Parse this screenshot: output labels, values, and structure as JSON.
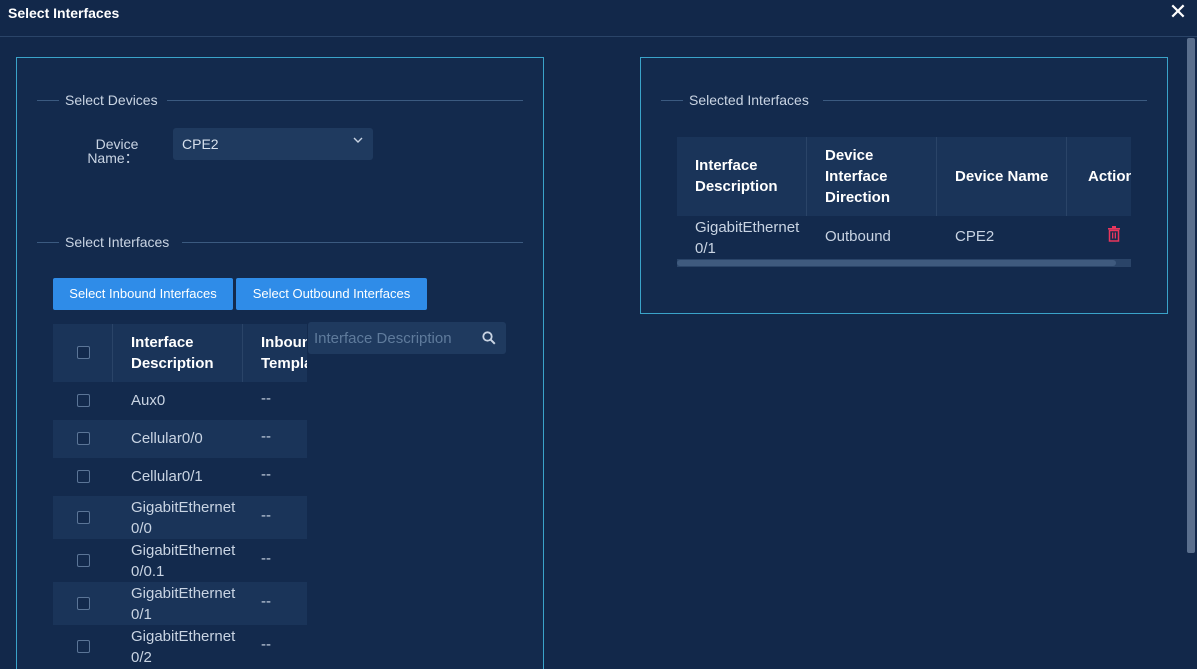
{
  "dialog": {
    "title": "Select Interfaces",
    "close_icon": "close-icon"
  },
  "left_panel": {
    "devices_section": "Select Devices",
    "device_name_label_1": "Device",
    "device_name_label_2": "Name：",
    "device_name_value": "CPE2",
    "interfaces_section": "Select Interfaces",
    "btn_inbound": "Select Inbound Interfaces",
    "btn_outbound": "Select Outbound Interfaces",
    "search_placeholder": "Interface Description",
    "table": {
      "col_desc_1": "Interface",
      "col_desc_2": "Description",
      "col_tmpl_1": "Inbound",
      "col_tmpl_2": "Template",
      "rows": [
        {
          "desc1": "Aux0",
          "desc2": "",
          "tmpl": "--"
        },
        {
          "desc1": "Cellular0/0",
          "desc2": "",
          "tmpl": "--"
        },
        {
          "desc1": "Cellular0/1",
          "desc2": "",
          "tmpl": "--"
        },
        {
          "desc1": "GigabitEthernet",
          "desc2": "0/0",
          "tmpl": "--"
        },
        {
          "desc1": "GigabitEthernet",
          "desc2": "0/0.1",
          "tmpl": "--"
        },
        {
          "desc1": "GigabitEthernet",
          "desc2": "0/1",
          "tmpl": "--"
        },
        {
          "desc1": "GigabitEthernet",
          "desc2": "0/2",
          "tmpl": "--"
        }
      ]
    }
  },
  "right_panel": {
    "section": "Selected Interfaces",
    "table": {
      "col1_1": "Interface",
      "col1_2": "Description",
      "col2_1": "Device",
      "col2_2": "Interface",
      "col2_3": "Direction",
      "col3": "Device Name",
      "col4": "Action",
      "rows": [
        {
          "desc1": "GigabitEthernet",
          "desc2": "0/1",
          "direction": "Outbound",
          "device": "CPE2"
        }
      ]
    }
  },
  "colors": {
    "background": "#12284a",
    "accent": "#2f8ce8",
    "border": "#3aa3c9",
    "delete": "#e8365d"
  }
}
